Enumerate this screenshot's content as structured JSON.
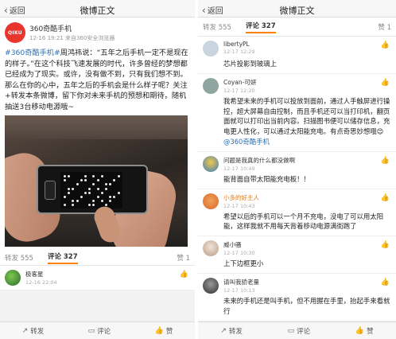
{
  "left": {
    "topbar": {
      "back_label": "返回",
      "title": "微博正文"
    },
    "post": {
      "avatar_text": "QIKU",
      "author": "360奇酷手机",
      "meta": "12-16 19:21  来自360安全浏览器",
      "text_hashtag": "#360奇酷手机#",
      "text_body_1": "周鸿祎说：“五年之后手机一定不是现在的样子。”在这个科技飞速发展的时代，许多曾经的梦想都已经成为了现实。或许，没有做不到，只有我们想不到。那么在你的心中，五年之后的手机会是什么样子呢？关注+转发本条微博，留下你对未来手机的预想和期待，随机抽送3台移动电源哦",
      "text_emoji": "~"
    },
    "tabs": {
      "repost": "转发 555",
      "comment": "评论 327",
      "like": "赞 1"
    },
    "comment": {
      "name": "极客星",
      "time": "12-16 22:04"
    },
    "bottombar": {
      "repost": "转发",
      "comment": "评论",
      "like": "赞"
    }
  },
  "right": {
    "topbar": {
      "back_label": "返回",
      "title": "微博正文"
    },
    "tabs": {
      "repost": "转发 555",
      "comment": "评论 327",
      "like": "赞 1"
    },
    "comments": [
      {
        "name": "libertyPL",
        "time": "12-17 12:29",
        "body": "芯片投影到玻璃上",
        "color": "#c8d4e0"
      },
      {
        "name": "Coyan-可妍",
        "time": "12-17 12:20",
        "body": "我希望未来的手机可以投放到面前，通过人手触屏进行操控，超大屏幕自由控制，而且手机还可以当打印机，翻页面就可以打印出当前内容。扫描图书便可以储存信息，充电更人性化，可以通过太阳能充电。有点奇思妙想哦",
        "mention": "@360奇酷手机",
        "color": "#8fa6a0"
      },
      {
        "name": "问题是我真的什么都没做啊",
        "time": "12-17 10:49",
        "body": "能背面自带太阳能充电板！！",
        "color": "#3a7bbf"
      },
      {
        "name": "小多的好主人",
        "time": "12-17 10:43",
        "body": "希望以后的手机可以一个月不充电，没电了可以用太阳能，这样我就不用每天背着移动电源满街跑了",
        "color": "#d9662b",
        "orange": true
      },
      {
        "name": "威小骚",
        "time": "12-17 10:30",
        "body": "上下边框更小",
        "color": "#d8c8bb"
      },
      {
        "name": "请叫我骄老量",
        "time": "12-17 10:13",
        "body": "未来的手机还是叫手机，但不用握在手里，抬起手来看就行",
        "color": "#5a5a5a"
      }
    ],
    "bottombar": {
      "repost": "转发",
      "comment": "评论",
      "like": "赞"
    }
  }
}
